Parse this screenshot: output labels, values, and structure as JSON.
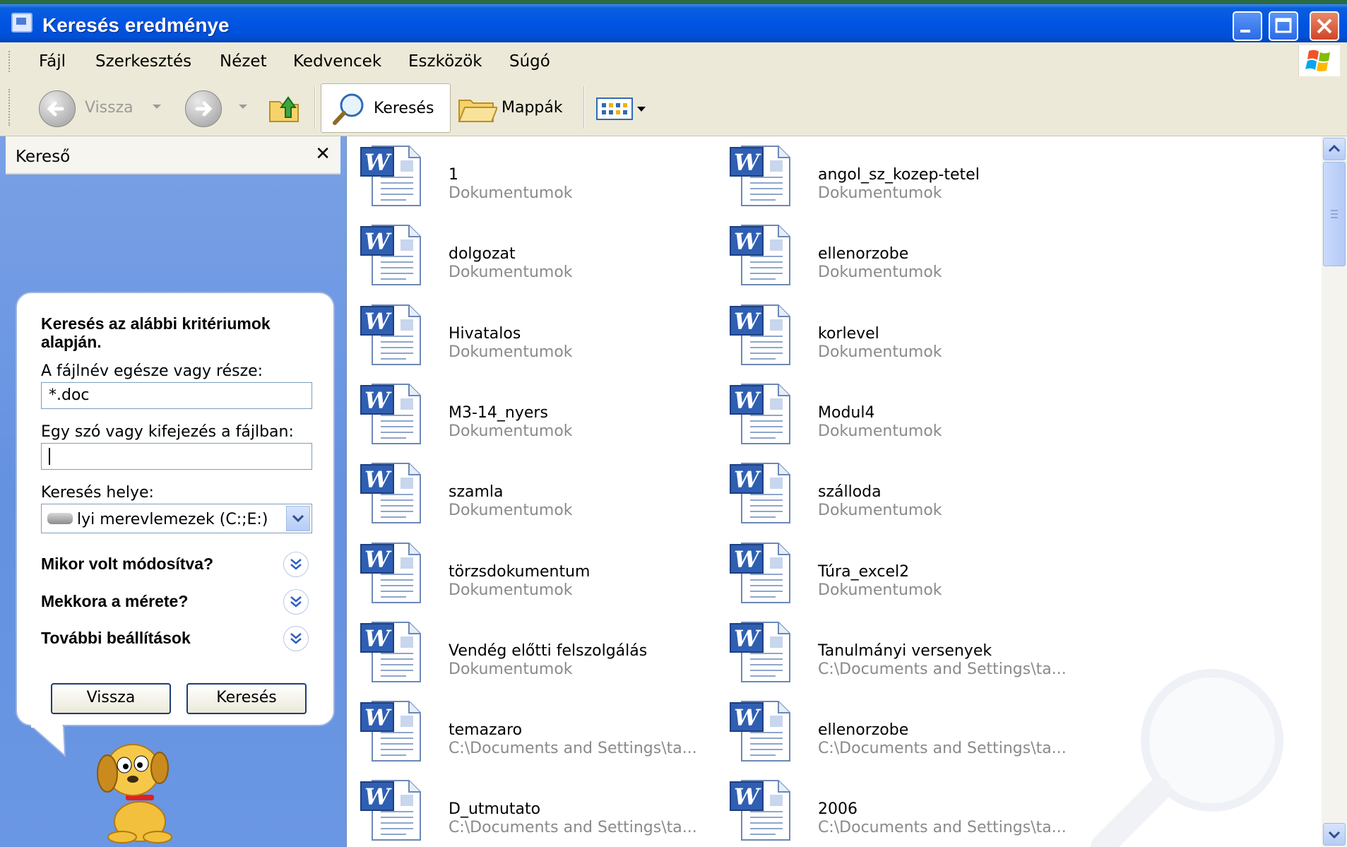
{
  "window": {
    "title": "Keresés eredménye"
  },
  "menu": [
    "Fájl",
    "Szerkesztés",
    "Nézet",
    "Kedvencek",
    "Eszközök",
    "Súgó"
  ],
  "toolbar": {
    "back_label": "Vissza",
    "search_label": "Keresés",
    "folders_label": "Mappák"
  },
  "search_panel": {
    "title": "Kereső",
    "close_glyph": "✕",
    "heading": "Keresés az alábbi kritériumok alapján.",
    "filename_label": "A fájlnév egésze vagy része:",
    "filename_value": "*.doc",
    "phrase_label": "Egy szó vagy kifejezés a fájlban:",
    "phrase_value": "",
    "location_label": "Keresés helye:",
    "location_value": "lyi merevlemezek (C:;E:)",
    "options": [
      "Mikor volt módosítva?",
      "Mekkora a mérete?",
      "További beállítások"
    ],
    "back_button": "Vissza",
    "search_button": "Keresés"
  },
  "files": [
    {
      "name": "1",
      "path": "Dokumentumok"
    },
    {
      "name": "angol_sz_kozep-tetel",
      "path": "Dokumentumok"
    },
    {
      "name": "dolgozat",
      "path": "Dokumentumok"
    },
    {
      "name": "ellenorzobe",
      "path": "Dokumentumok"
    },
    {
      "name": "Hivatalos",
      "path": "Dokumentumok"
    },
    {
      "name": "korlevel",
      "path": "Dokumentumok"
    },
    {
      "name": "M3-14_nyers",
      "path": "Dokumentumok"
    },
    {
      "name": "Modul4",
      "path": "Dokumentumok"
    },
    {
      "name": "szamla",
      "path": "Dokumentumok"
    },
    {
      "name": "szálloda",
      "path": "Dokumentumok"
    },
    {
      "name": "törzsdokumentum",
      "path": "Dokumentumok"
    },
    {
      "name": "Túra_excel2",
      "path": "Dokumentumok"
    },
    {
      "name": "Vendég előtti felszolgálás",
      "path": "Dokumentumok"
    },
    {
      "name": "Tanulmányi versenyek",
      "path": "C:\\Documents and Settings\\ta..."
    },
    {
      "name": "temazaro",
      "path": "C:\\Documents and Settings\\ta..."
    },
    {
      "name": "ellenorzobe",
      "path": "C:\\Documents and Settings\\ta..."
    },
    {
      "name": "D_utmutato",
      "path": "C:\\Documents and Settings\\ta..."
    },
    {
      "name": "2006",
      "path": "C:\\Documents and Settings\\ta..."
    }
  ],
  "colors": {
    "titlebar": "#0054e3",
    "side_panel": "#6a97e3",
    "path_text": "#8a8a8a"
  },
  "icons": {
    "file": "word-document-icon"
  }
}
